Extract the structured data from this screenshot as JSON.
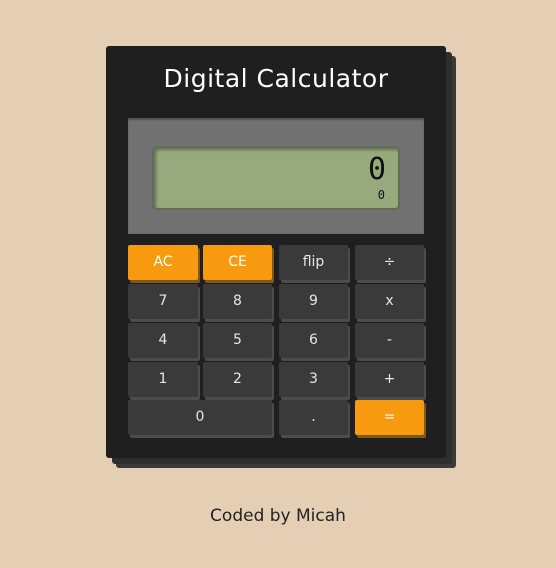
{
  "calculator": {
    "title": "Digital Calculator",
    "display": {
      "main_value": "0",
      "sub_value": "0"
    },
    "keys": {
      "ac": "AC",
      "ce": "CE",
      "flip": "flip",
      "divide": "÷",
      "seven": "7",
      "eight": "8",
      "nine": "9",
      "multiply": "x",
      "four": "4",
      "five": "5",
      "six": "6",
      "minus": "-",
      "one": "1",
      "two": "2",
      "three": "3",
      "plus": "+",
      "zero": "0",
      "decimal": ".",
      "equals": "="
    }
  },
  "footer": {
    "credit": "Coded by Micah"
  },
  "colors": {
    "background": "#e4cfb5",
    "body": "#1f1f1f",
    "display_panel": "#717171",
    "lcd": "#97aa7d",
    "key": "#3a3a3a",
    "accent_key": "#f79a0f"
  }
}
